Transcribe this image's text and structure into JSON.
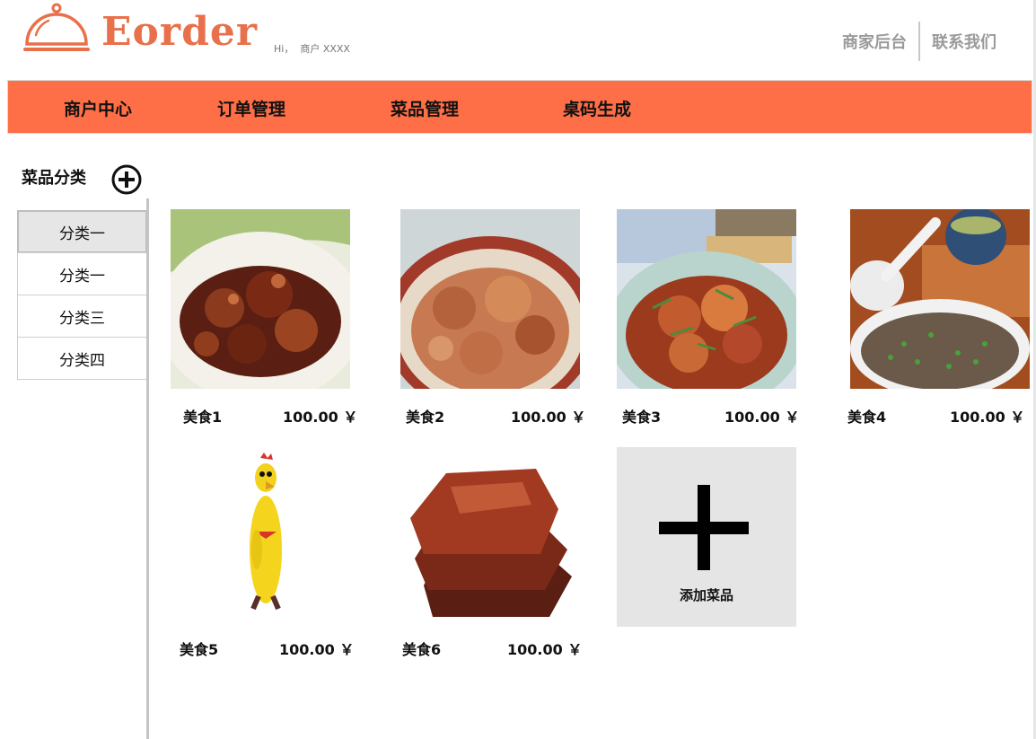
{
  "brand": {
    "name": "Eorder",
    "color": "#E8704A"
  },
  "header": {
    "greeting": "Hi，  商户 XXXX",
    "links": [
      "商家后台",
      "联系我们"
    ]
  },
  "nav": {
    "bg_color": "#FF6F47",
    "items": [
      "商户中心",
      "订单管理",
      "菜品管理",
      "桌码生成"
    ]
  },
  "sidebar": {
    "title": "菜品分类",
    "add_icon": "plus-circle-icon",
    "categories": [
      "分类一",
      "分类一",
      "分类三",
      "分类四"
    ],
    "active_index": 0
  },
  "dishes": [
    {
      "name": "美食1",
      "price": "100.00 ￥",
      "image": "braised-chicken-photo"
    },
    {
      "name": "美食2",
      "price": "100.00 ￥",
      "image": "braised-pork-photo"
    },
    {
      "name": "美食3",
      "price": "100.00 ￥",
      "image": "fish-stew-photo"
    },
    {
      "name": "美食4",
      "price": "100.00 ￥",
      "image": "steamed-minced-meat-photo"
    },
    {
      "name": "美食5",
      "price": "100.00 ￥",
      "image": "rubber-chicken-toy-photo"
    },
    {
      "name": "美食6",
      "price": "100.00 ￥",
      "image": "bakkwa-jerky-photo"
    }
  ],
  "add_dish": {
    "label": "添加菜品",
    "icon": "plus-icon"
  }
}
